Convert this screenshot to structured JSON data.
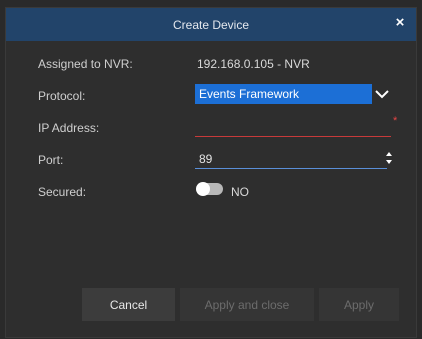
{
  "dialog": {
    "title": "Create Device",
    "close_glyph": "×"
  },
  "form": {
    "assigned": {
      "label": "Assigned to NVR:",
      "value": "192.168.0.105 - NVR"
    },
    "protocol": {
      "label": "Protocol:",
      "selected": "Events Framework"
    },
    "ip_address": {
      "label": "IP Address:",
      "value": "",
      "required_marker": "*"
    },
    "port": {
      "label": "Port:",
      "value": "89"
    },
    "secured": {
      "label": "Secured:",
      "state_text": "NO",
      "on": false
    }
  },
  "buttons": {
    "cancel": "Cancel",
    "apply_and_close": "Apply and close",
    "apply": "Apply"
  },
  "colors": {
    "titlebar": "#22446a",
    "select_bg": "#1c6fd6",
    "required": "#e84545",
    "port_underline": "#5a8fd8"
  },
  "icons": {
    "close": "close-icon",
    "dropdown": "chevron-down-icon",
    "spinner": "spinner-arrows-icon",
    "toggle": "toggle-switch"
  }
}
